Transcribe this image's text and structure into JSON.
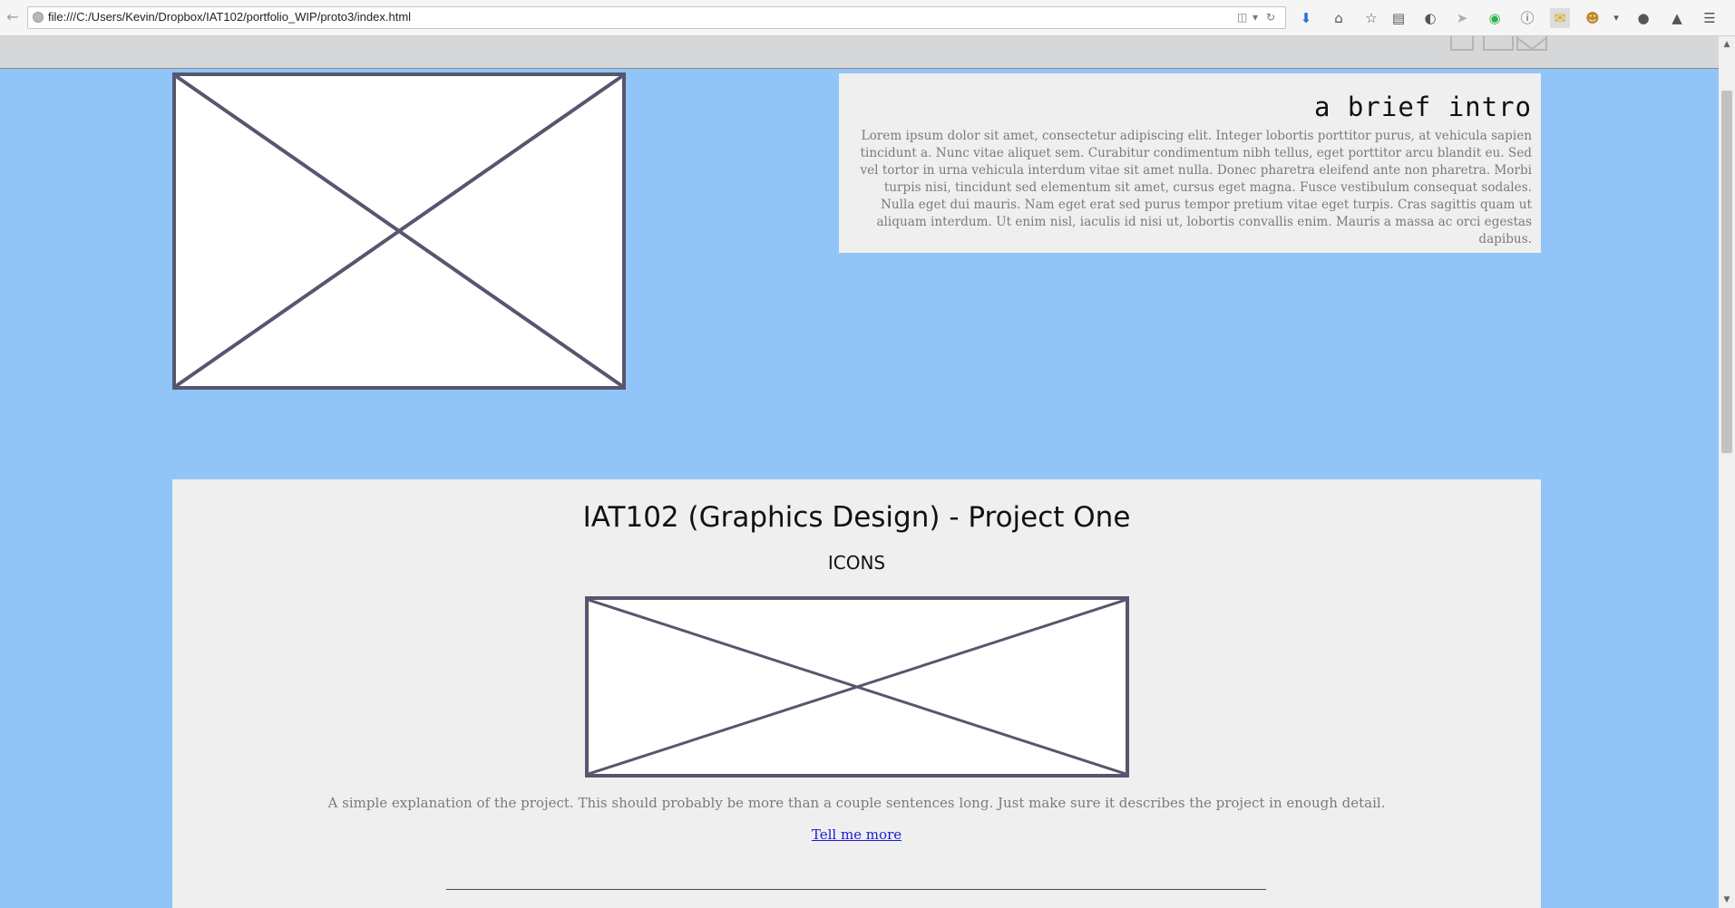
{
  "browser": {
    "url": "file:///C:/Users/Kevin/Dropbox/IAT102/portfolio_WIP/proto3/index.html",
    "icons": [
      "back-icon",
      "reader-view-icon",
      "reload-icon",
      "download-icon",
      "home-icon",
      "bookmark-star-icon",
      "library-icon",
      "pocket-icon",
      "send-icon",
      "extension-green-icon",
      "info-icon",
      "extension-note-icon",
      "greasemonkey-icon",
      "dropdown-icon",
      "chat-icon",
      "lock-icon",
      "menu-icon"
    ]
  },
  "intro": {
    "heading": "a brief intro",
    "body": "Lorem ipsum dolor sit amet, consectetur adipiscing elit. Integer lobortis porttitor purus, at vehicula sapien tincidunt a. Nunc vitae aliquet sem. Curabitur condimentum nibh tellus, eget porttitor arcu blandit eu. Sed vel tortor in urna vehicula interdum vitae sit amet nulla. Donec pharetra eleifend ante non pharetra. Morbi turpis nisi, tincidunt sed elementum sit amet, cursus eget magna. Fusce vestibulum consequat sodales. Nulla eget dui mauris. Nam eget erat sed purus tempor pretium vitae eget turpis. Cras sagittis quam ut aliquam interdum. Ut enim nisl, iaculis id nisi ut, lobortis convallis enim. Mauris a massa ac orci egestas dapibus."
  },
  "project": {
    "title": "IAT102 (Graphics Design) - Project One",
    "subtitle": "ICONS",
    "description": "A simple explanation of the project. This should probably be more than a couple sentences long. Just make sure it describes the project in enough detail.",
    "link": "Tell me more"
  },
  "colors": {
    "page_background": "#91c5f8",
    "card_background": "#efefef",
    "header_bar": "#d6d7d8",
    "placeholder_border": "#58566e",
    "link": "#1a1adb"
  }
}
